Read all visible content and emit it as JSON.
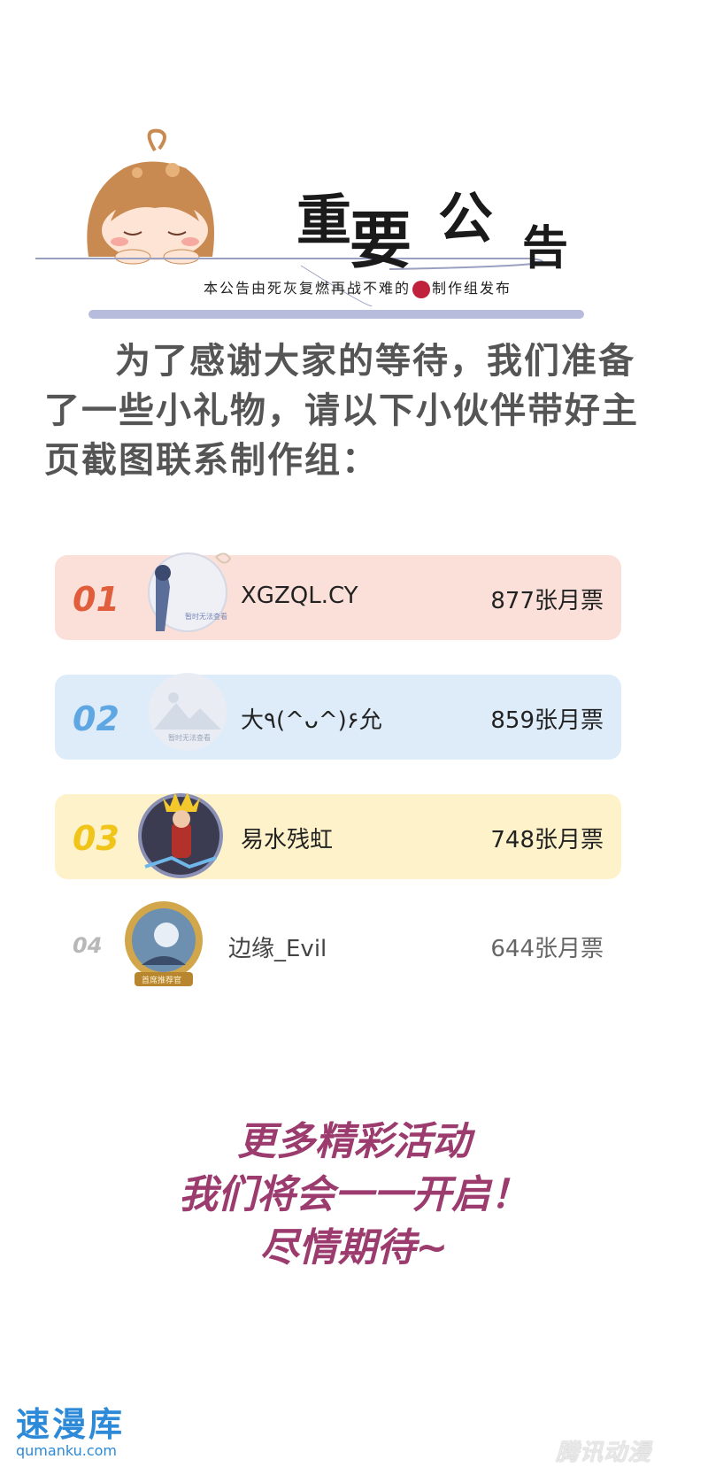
{
  "notice": {
    "title_chars": [
      "重",
      "要",
      "公",
      "告"
    ],
    "subtitle_before": "本公告由死灰复燃再战不难的",
    "subtitle_after": "制作组发布"
  },
  "intro": {
    "line1": "为了感谢大家的等待，我们准备",
    "line2": "了一些小礼物，请以下小伙伴带好主",
    "line3": "页截图联系制作组："
  },
  "ranking": [
    {
      "rank": "01",
      "name": "XGZQL.CY",
      "votes": "877张月票",
      "avatar_caption": "暂时无法查看"
    },
    {
      "rank": "02",
      "name": "大٩(^ᴗ^)۶允",
      "votes": "859张月票",
      "avatar_caption": "暂时无法查看"
    },
    {
      "rank": "03",
      "name": "易水残虹",
      "votes": "748张月票"
    },
    {
      "rank": "04",
      "name": "边缘_Evil",
      "votes": "644张月票",
      "avatar_caption": "首席推荐官"
    }
  ],
  "closing": {
    "line1": "更多精彩活动",
    "line2": "我们将会一一开启！",
    "line3": "尽情期待~"
  },
  "footer": {
    "left_logo": "速漫库",
    "left_url": "qumanku.com",
    "right_logo": "腾讯动漫"
  },
  "colors": {
    "rank1_bg": "#fbe0d9",
    "rank2_bg": "#deecfa",
    "rank3_bg": "#fdf2c9",
    "closing_text": "#9c3b6e"
  }
}
